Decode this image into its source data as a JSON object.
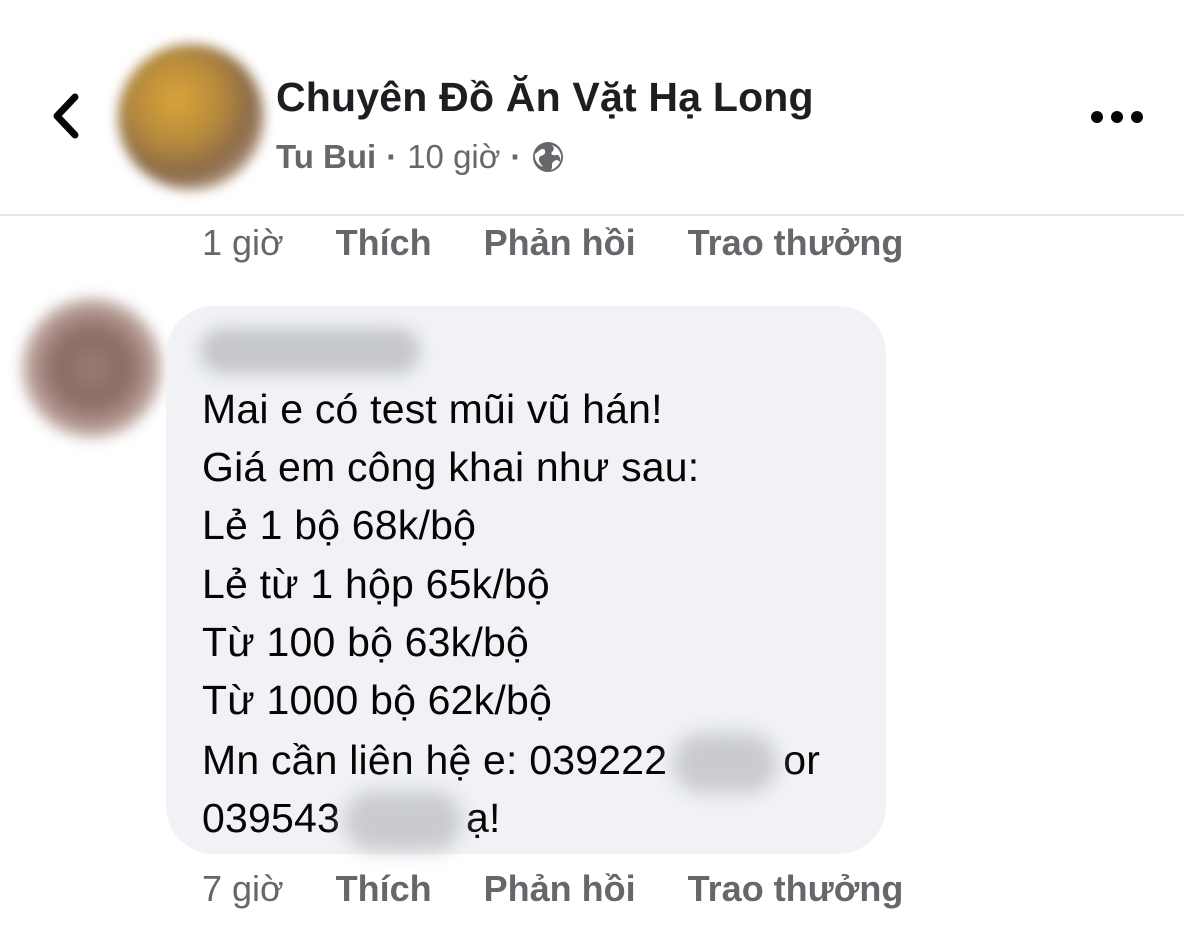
{
  "header": {
    "group_name": "Chuyên Đồ Ăn Vặt Hạ Long",
    "author": "Tu Bui",
    "separator": "·",
    "time": "10 giờ",
    "icons": {
      "back": "chevron-left-icon",
      "privacy": "globe-icon",
      "more": "more-horizontal-icon"
    }
  },
  "prev_comment_actions": {
    "time": "1 giờ",
    "like": "Thích",
    "reply": "Phản hồi",
    "award": "Trao thưởng"
  },
  "comment": {
    "lines": [
      "Mai e có test mũi vũ hán!",
      "Giá em công khai như sau:",
      "Lẻ 1 bộ 68k/bộ",
      "Lẻ từ 1 hộp 65k/bộ",
      "Từ 100 bộ 63k/bộ",
      "Từ 1000 bộ 62k/bộ"
    ],
    "contact_prefix": "Mn cần liên hệ e: 039222",
    "contact_middle": "or",
    "contact_phone2": "039543",
    "contact_suffix": "ạ!"
  },
  "comment_actions": {
    "time": "7 giờ",
    "like": "Thích",
    "reply": "Phản hồi",
    "award": "Trao thưởng"
  },
  "colors": {
    "text_primary": "#050505",
    "text_secondary": "#65676b",
    "bubble_bg": "#f0f2f5",
    "divider": "#e4e6eb"
  }
}
